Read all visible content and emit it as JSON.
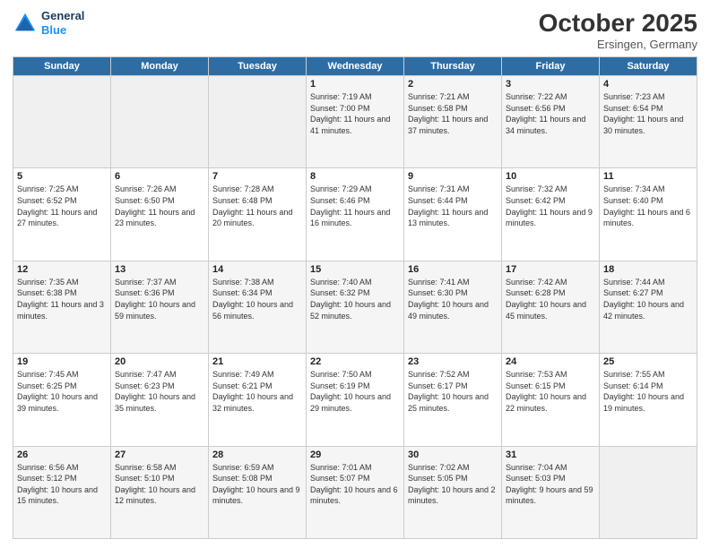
{
  "header": {
    "logo_line1": "General",
    "logo_line2": "Blue",
    "month": "October 2025",
    "location": "Ersingen, Germany"
  },
  "weekdays": [
    "Sunday",
    "Monday",
    "Tuesday",
    "Wednesday",
    "Thursday",
    "Friday",
    "Saturday"
  ],
  "weeks": [
    [
      {
        "day": "",
        "info": ""
      },
      {
        "day": "",
        "info": ""
      },
      {
        "day": "",
        "info": ""
      },
      {
        "day": "1",
        "info": "Sunrise: 7:19 AM\nSunset: 7:00 PM\nDaylight: 11 hours and 41 minutes."
      },
      {
        "day": "2",
        "info": "Sunrise: 7:21 AM\nSunset: 6:58 PM\nDaylight: 11 hours and 37 minutes."
      },
      {
        "day": "3",
        "info": "Sunrise: 7:22 AM\nSunset: 6:56 PM\nDaylight: 11 hours and 34 minutes."
      },
      {
        "day": "4",
        "info": "Sunrise: 7:23 AM\nSunset: 6:54 PM\nDaylight: 11 hours and 30 minutes."
      }
    ],
    [
      {
        "day": "5",
        "info": "Sunrise: 7:25 AM\nSunset: 6:52 PM\nDaylight: 11 hours and 27 minutes."
      },
      {
        "day": "6",
        "info": "Sunrise: 7:26 AM\nSunset: 6:50 PM\nDaylight: 11 hours and 23 minutes."
      },
      {
        "day": "7",
        "info": "Sunrise: 7:28 AM\nSunset: 6:48 PM\nDaylight: 11 hours and 20 minutes."
      },
      {
        "day": "8",
        "info": "Sunrise: 7:29 AM\nSunset: 6:46 PM\nDaylight: 11 hours and 16 minutes."
      },
      {
        "day": "9",
        "info": "Sunrise: 7:31 AM\nSunset: 6:44 PM\nDaylight: 11 hours and 13 minutes."
      },
      {
        "day": "10",
        "info": "Sunrise: 7:32 AM\nSunset: 6:42 PM\nDaylight: 11 hours and 9 minutes."
      },
      {
        "day": "11",
        "info": "Sunrise: 7:34 AM\nSunset: 6:40 PM\nDaylight: 11 hours and 6 minutes."
      }
    ],
    [
      {
        "day": "12",
        "info": "Sunrise: 7:35 AM\nSunset: 6:38 PM\nDaylight: 11 hours and 3 minutes."
      },
      {
        "day": "13",
        "info": "Sunrise: 7:37 AM\nSunset: 6:36 PM\nDaylight: 10 hours and 59 minutes."
      },
      {
        "day": "14",
        "info": "Sunrise: 7:38 AM\nSunset: 6:34 PM\nDaylight: 10 hours and 56 minutes."
      },
      {
        "day": "15",
        "info": "Sunrise: 7:40 AM\nSunset: 6:32 PM\nDaylight: 10 hours and 52 minutes."
      },
      {
        "day": "16",
        "info": "Sunrise: 7:41 AM\nSunset: 6:30 PM\nDaylight: 10 hours and 49 minutes."
      },
      {
        "day": "17",
        "info": "Sunrise: 7:42 AM\nSunset: 6:28 PM\nDaylight: 10 hours and 45 minutes."
      },
      {
        "day": "18",
        "info": "Sunrise: 7:44 AM\nSunset: 6:27 PM\nDaylight: 10 hours and 42 minutes."
      }
    ],
    [
      {
        "day": "19",
        "info": "Sunrise: 7:45 AM\nSunset: 6:25 PM\nDaylight: 10 hours and 39 minutes."
      },
      {
        "day": "20",
        "info": "Sunrise: 7:47 AM\nSunset: 6:23 PM\nDaylight: 10 hours and 35 minutes."
      },
      {
        "day": "21",
        "info": "Sunrise: 7:49 AM\nSunset: 6:21 PM\nDaylight: 10 hours and 32 minutes."
      },
      {
        "day": "22",
        "info": "Sunrise: 7:50 AM\nSunset: 6:19 PM\nDaylight: 10 hours and 29 minutes."
      },
      {
        "day": "23",
        "info": "Sunrise: 7:52 AM\nSunset: 6:17 PM\nDaylight: 10 hours and 25 minutes."
      },
      {
        "day": "24",
        "info": "Sunrise: 7:53 AM\nSunset: 6:15 PM\nDaylight: 10 hours and 22 minutes."
      },
      {
        "day": "25",
        "info": "Sunrise: 7:55 AM\nSunset: 6:14 PM\nDaylight: 10 hours and 19 minutes."
      }
    ],
    [
      {
        "day": "26",
        "info": "Sunrise: 6:56 AM\nSunset: 5:12 PM\nDaylight: 10 hours and 15 minutes."
      },
      {
        "day": "27",
        "info": "Sunrise: 6:58 AM\nSunset: 5:10 PM\nDaylight: 10 hours and 12 minutes."
      },
      {
        "day": "28",
        "info": "Sunrise: 6:59 AM\nSunset: 5:08 PM\nDaylight: 10 hours and 9 minutes."
      },
      {
        "day": "29",
        "info": "Sunrise: 7:01 AM\nSunset: 5:07 PM\nDaylight: 10 hours and 6 minutes."
      },
      {
        "day": "30",
        "info": "Sunrise: 7:02 AM\nSunset: 5:05 PM\nDaylight: 10 hours and 2 minutes."
      },
      {
        "day": "31",
        "info": "Sunrise: 7:04 AM\nSunset: 5:03 PM\nDaylight: 9 hours and 59 minutes."
      },
      {
        "day": "",
        "info": ""
      }
    ]
  ]
}
